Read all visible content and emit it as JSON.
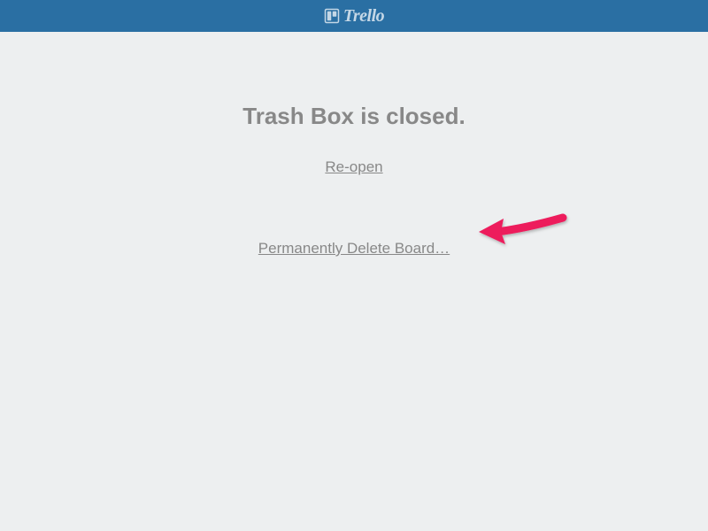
{
  "header": {
    "brand": "Trello"
  },
  "main": {
    "title": "Trash Box is closed.",
    "reopen_label": "Re-open",
    "delete_label": "Permanently Delete Board…"
  },
  "annotation": {
    "arrow_color": "#ed1a5b"
  }
}
